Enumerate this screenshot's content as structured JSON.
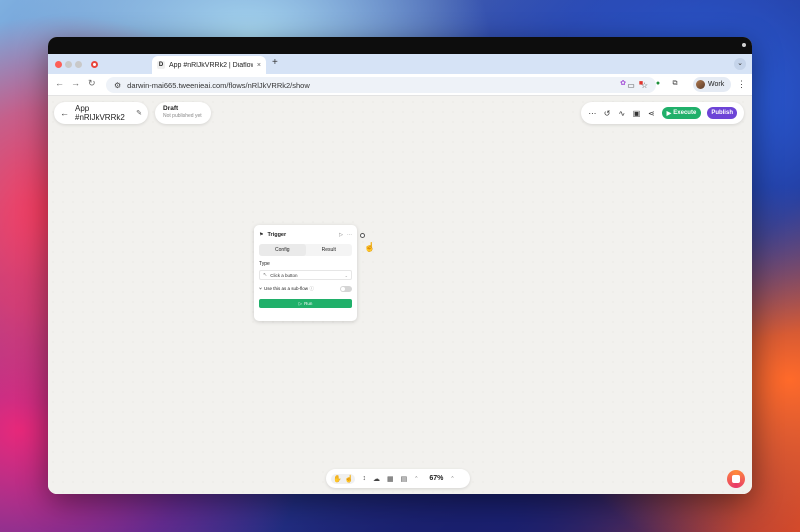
{
  "browser": {
    "tab_title": "App #nRlJkVRRk2 | Diaflow",
    "tab_favicon": "D",
    "close_glyph": "×",
    "new_tab_glyph": "+",
    "tab_menu_glyph": "⌄",
    "url": "darwin-mai665.tweenieai.com/flows/nRlJkVRRk2/show",
    "profile_label": "Work",
    "menu_glyph": "⋮",
    "icons": {
      "back": "←",
      "forward": "→",
      "reload": "↻",
      "site_info": "⚙",
      "install": "▭",
      "bookmark": "☆",
      "ext1": "✿",
      "ext2": "■",
      "ext3": "●",
      "extensions": "⧉"
    }
  },
  "app": {
    "back_glyph": "←",
    "name": "App #nRlJkVRRk2",
    "edit_glyph": "✎",
    "status": {
      "label": "Draft",
      "sub": "Not published yet"
    },
    "actions": {
      "more": "⋯",
      "history": "↺",
      "activity": "∿",
      "save": "▣",
      "share": "⋖",
      "execute_label": "Execute",
      "execute_icon": "▶",
      "publish_label": "Publish"
    }
  },
  "node": {
    "flag_icon": "⚑",
    "title": "Trigger",
    "play_icon": "▷",
    "more_icon": "⋯",
    "tabs": [
      "Config",
      "Result"
    ],
    "type_label": "Type",
    "type_icon": "↖",
    "type_value": "Click a button",
    "chevron": "⌄",
    "subflow_icon": "⑂",
    "subflow_label": "Use this as a sub-flow",
    "info_icon": "ⓘ",
    "run_icon": "▷",
    "run_label": "Run"
  },
  "canvas": {
    "cursor_glyph": "☝"
  },
  "bottom_toolbar": {
    "hand": "✋",
    "pointer": "☝",
    "fit": "↕",
    "comment": "☁",
    "grid": "▦",
    "layout": "▤",
    "caret": "⌃",
    "zoom": "67%"
  }
}
